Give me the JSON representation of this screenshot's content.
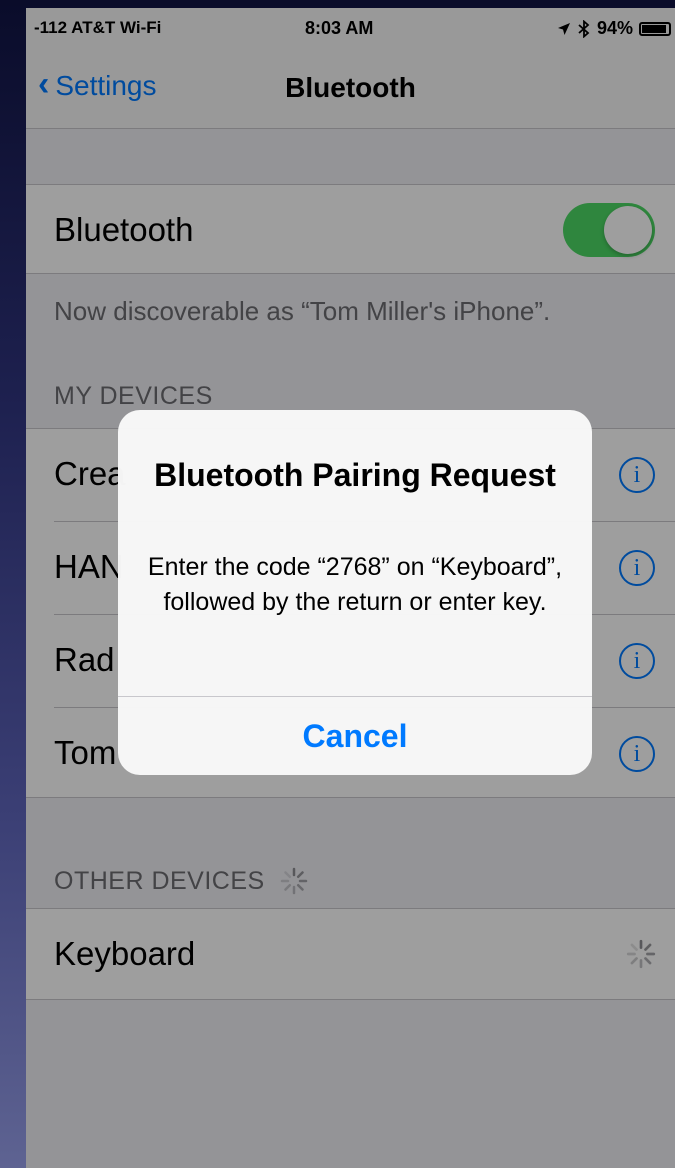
{
  "status_bar": {
    "carrier": "-112 AT&T Wi-Fi",
    "time": "8:03 AM",
    "battery": "94%",
    "battery_level": 0.94
  },
  "nav": {
    "back_label": "Settings",
    "title": "Bluetooth"
  },
  "bluetooth_cell": {
    "label": "Bluetooth",
    "toggle_on": true
  },
  "discoverable_text": "Now discoverable as “Tom Miller's iPhone”.",
  "my_devices": {
    "header": "MY DEVICES",
    "items": [
      {
        "label": "Crea"
      },
      {
        "label": "HAN"
      },
      {
        "label": "Rad"
      },
      {
        "label": "Tom"
      }
    ]
  },
  "other_devices": {
    "header": "OTHER DEVICES",
    "items": [
      {
        "label": "Keyboard"
      }
    ]
  },
  "alert": {
    "title": "Bluetooth Pairing Request",
    "message": "Enter the code “2768” on “Keyboard”, followed by the return or enter key.",
    "cancel_label": "Cancel"
  },
  "colors": {
    "accent": "#007aff",
    "toggle_on": "#4cd964",
    "group_background": "#efeff4"
  },
  "icons": {
    "back": "chevron-left-icon",
    "info": "info-icon",
    "loading": "activity-spinner-icon",
    "wifi": "wifi-icon",
    "location": "location-arrow-icon",
    "bluetooth": "bluetooth-icon",
    "battery": "battery-icon"
  }
}
